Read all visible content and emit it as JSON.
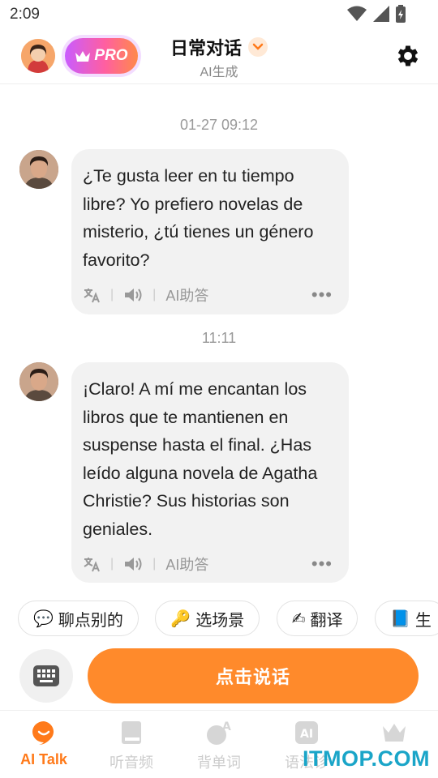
{
  "status": {
    "time": "2:09"
  },
  "header": {
    "pro_label": "PRO",
    "title": "日常对话",
    "subtitle": "AI生成"
  },
  "messages": [
    {
      "timestamp": "01-27 09:12",
      "text": "¿Te gusta leer en tu tiempo libre? Yo prefiero novelas de misterio, ¿tú tienes un género favorito?",
      "ai_answer_label": "AI助答",
      "more": "•••"
    },
    {
      "timestamp": "11:11",
      "text": "¡Claro! A mí me encantan los libros que te mantienen en suspense hasta el final. ¿Has leído alguna novela de Agatha Christie? Sus historias son geniales.",
      "ai_answer_label": "AI助答",
      "more": "•••"
    }
  ],
  "chips": [
    {
      "icon": "💬",
      "label": "聊点别的"
    },
    {
      "icon": "🔑",
      "label": "选场景"
    },
    {
      "icon": "✍",
      "label": "翻译"
    },
    {
      "icon": "📘",
      "label": "生"
    }
  ],
  "input": {
    "talk_label": "点击说话"
  },
  "nav": [
    {
      "label": "AI Talk",
      "active": true
    },
    {
      "label": "听音频",
      "active": false
    },
    {
      "label": "背单词",
      "active": false
    },
    {
      "label": "语法诊",
      "active": false
    },
    {
      "label": "",
      "active": false
    }
  ],
  "watermark": "ITMOP.COM",
  "colors": {
    "accent": "#ff8a2b",
    "bubble": "#f2f2f2",
    "watermark": "#1aa5c8"
  }
}
